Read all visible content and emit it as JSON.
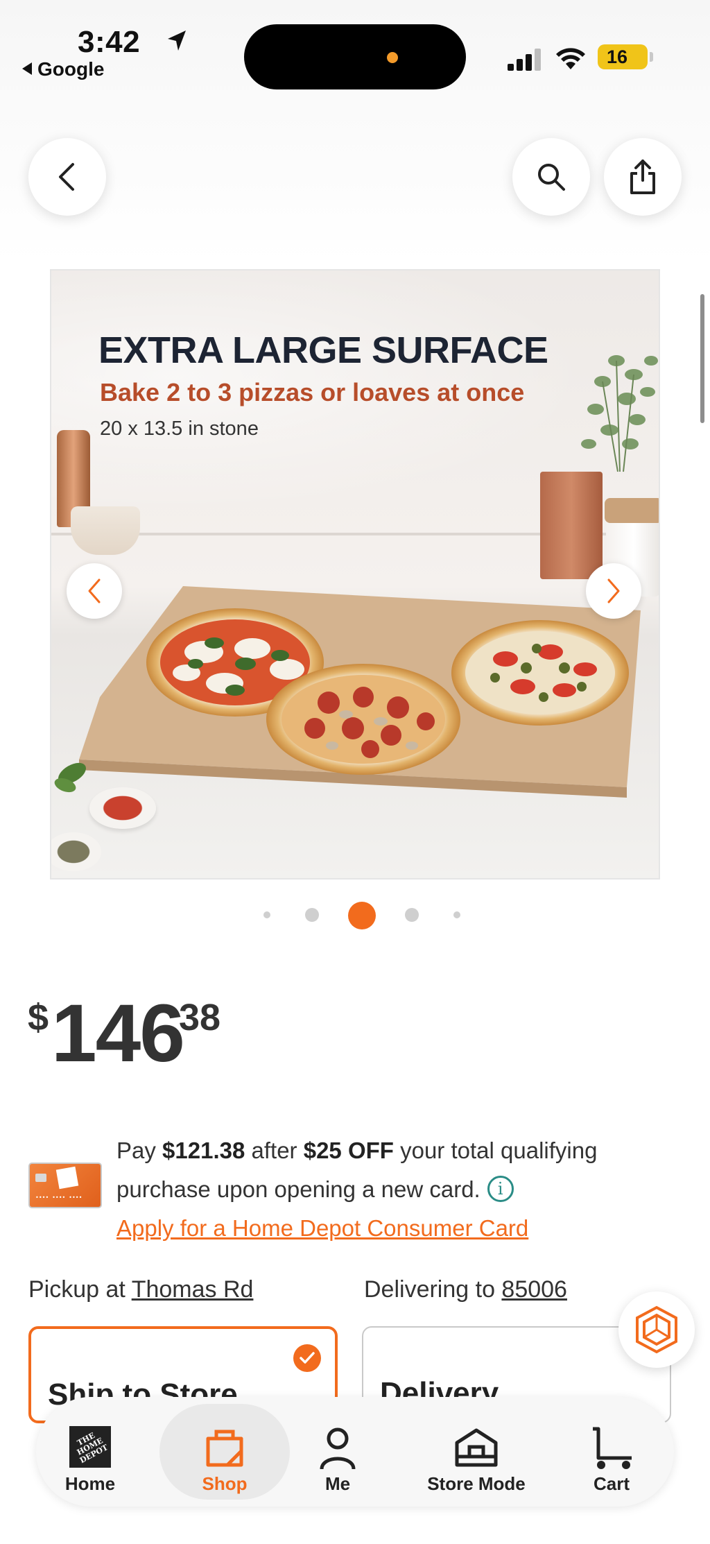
{
  "status_bar": {
    "time": "3:42",
    "back_app": "Google",
    "battery": "16"
  },
  "header": {
    "back_icon": "chevron-left-icon",
    "search_icon": "search-icon",
    "share_icon": "share-icon"
  },
  "product_image": {
    "headline": "EXTRA LARGE SURFACE",
    "subheadline": "Bake 2 to 3 pizzas or loaves at once",
    "caption": "20 x 13.5 in stone",
    "current_index": 2,
    "total_images": 5
  },
  "price": {
    "currency": "$",
    "dollars": "146",
    "cents": "38"
  },
  "credit_offer": {
    "text_pay": "Pay ",
    "discounted_price": "$121.38",
    "text_after": " after ",
    "discount": "$25 OFF",
    "text_rest": " your total qualifying purchase upon opening a new card.",
    "apply_link": "Apply for a Home Depot Consumer Card"
  },
  "fulfillment": {
    "pickup_prefix": "Pickup at ",
    "pickup_store": "Thomas Rd",
    "delivery_prefix": "Delivering to ",
    "delivery_zip": "85006",
    "ship_to_store_label": "Ship to Store",
    "delivery_label": "Delivery"
  },
  "tab_bar": {
    "items": [
      {
        "label": "Home",
        "icon": "home-depot-logo-icon"
      },
      {
        "label": "Shop",
        "icon": "shop-icon"
      },
      {
        "label": "Me",
        "icon": "person-icon"
      },
      {
        "label": "Store Mode",
        "icon": "store-icon"
      },
      {
        "label": "Cart",
        "icon": "cart-icon"
      }
    ],
    "active": "Shop"
  },
  "colors": {
    "accent": "#f26b1d",
    "text": "#333333",
    "info": "#2a8c86"
  }
}
